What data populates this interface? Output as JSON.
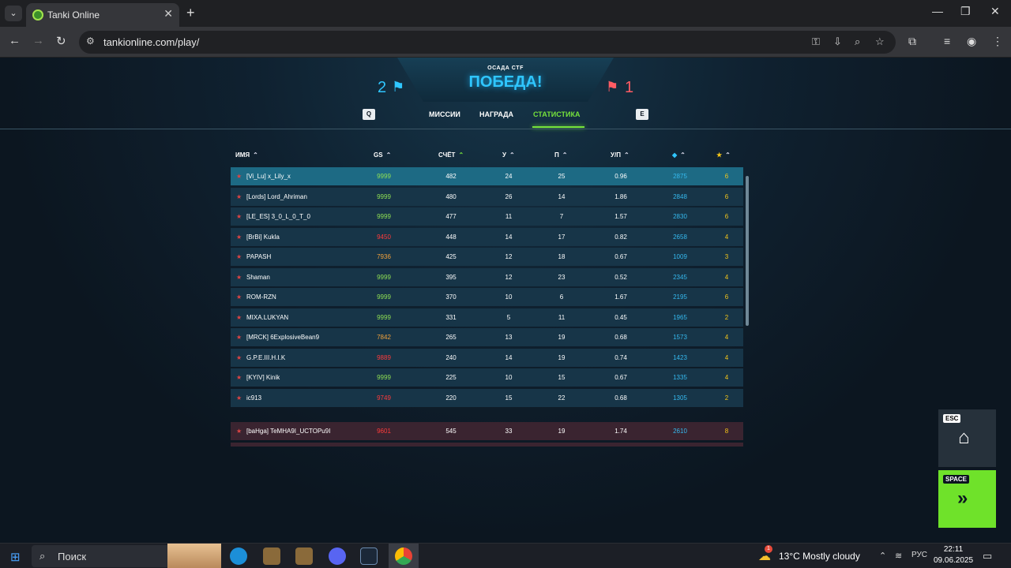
{
  "browser": {
    "tab_title": "Tanki Online",
    "url": "tankionline.com/play/"
  },
  "match": {
    "mode": "ОСАДА CTF",
    "result": "ПОБЕДА!",
    "score_blue": "2",
    "score_red": "1",
    "key_prev": "Q",
    "key_next": "E",
    "tabs": [
      "МИССИИ",
      "НАГРАДА",
      "СТАТИСТИКА"
    ],
    "active_tab": "СТАТИСТИКА"
  },
  "columns": [
    "ИМЯ",
    "GS",
    "СЧЁТ",
    "У",
    "П",
    "У/П",
    "crystals",
    "stars"
  ],
  "blue_team": [
    {
      "name": "[Vi_Lu] x_Lily_x",
      "gs": "9999",
      "gs_color": "#8fe053",
      "score": "482",
      "k": "24",
      "d": "25",
      "kd": "0.96",
      "crystals": "2875",
      "stars": "6",
      "highlight": true
    },
    {
      "name": "[Lords] Lord_Ahriman",
      "gs": "9999",
      "gs_color": "#8fe053",
      "score": "480",
      "k": "26",
      "d": "14",
      "kd": "1.86",
      "crystals": "2848",
      "stars": "6"
    },
    {
      "name": "[LE_ES] 3_0_L_0_T_0",
      "gs": "9999",
      "gs_color": "#8fe053",
      "score": "477",
      "k": "11",
      "d": "7",
      "kd": "1.57",
      "crystals": "2830",
      "stars": "6"
    },
    {
      "name": "[BrBi] Kukla",
      "gs": "9450",
      "gs_color": "#ff3b3b",
      "score": "448",
      "k": "14",
      "d": "17",
      "kd": "0.82",
      "crystals": "2658",
      "stars": "4"
    },
    {
      "name": "PAPASH",
      "gs": "7936",
      "gs_color": "#f2a23b",
      "score": "425",
      "k": "12",
      "d": "18",
      "kd": "0.67",
      "crystals": "1009",
      "stars": "3"
    },
    {
      "name": "Shaman",
      "gs": "9999",
      "gs_color": "#8fe053",
      "score": "395",
      "k": "12",
      "d": "23",
      "kd": "0.52",
      "crystals": "2345",
      "stars": "4"
    },
    {
      "name": "ROM-RZN",
      "gs": "9999",
      "gs_color": "#8fe053",
      "score": "370",
      "k": "10",
      "d": "6",
      "kd": "1.67",
      "crystals": "2195",
      "stars": "6"
    },
    {
      "name": "MIXA.LUKYAN",
      "gs": "9999",
      "gs_color": "#8fe053",
      "score": "331",
      "k": "5",
      "d": "11",
      "kd": "0.45",
      "crystals": "1965",
      "stars": "2"
    },
    {
      "name": "[MRCK] 6ExplosiveBean9",
      "gs": "7842",
      "gs_color": "#f2a23b",
      "score": "265",
      "k": "13",
      "d": "19",
      "kd": "0.68",
      "crystals": "1573",
      "stars": "4"
    },
    {
      "name": "G.P.E.III.H.I.K",
      "gs": "9889",
      "gs_color": "#ff3b3b",
      "score": "240",
      "k": "14",
      "d": "19",
      "kd": "0.74",
      "crystals": "1423",
      "stars": "4"
    },
    {
      "name": "[KYIV] Kinik",
      "gs": "9999",
      "gs_color": "#8fe053",
      "score": "225",
      "k": "10",
      "d": "15",
      "kd": "0.67",
      "crystals": "1335",
      "stars": "4"
    },
    {
      "name": "ic913",
      "gs": "9749",
      "gs_color": "#ff3b3b",
      "score": "220",
      "k": "15",
      "d": "22",
      "kd": "0.68",
      "crystals": "1305",
      "stars": "2"
    }
  ],
  "red_team": [
    {
      "name": "[baHga] TeMHA9I_UCTOPu9I",
      "gs": "9601",
      "gs_color": "#ff3b3b",
      "score": "545",
      "k": "33",
      "d": "19",
      "kd": "1.74",
      "crystals": "2610",
      "stars": "8"
    }
  ],
  "side_buttons": {
    "esc": "ESC",
    "space": "SPACE"
  },
  "taskbar": {
    "search_placeholder": "Поиск",
    "weather": "13°C  Mostly cloudy",
    "weather_badge": "1",
    "lang": "РУС",
    "time": "22:11",
    "date": "09.06.2025"
  }
}
